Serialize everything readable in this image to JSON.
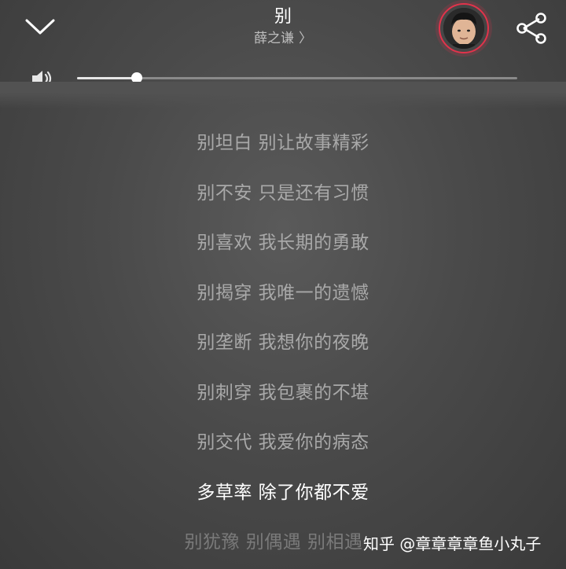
{
  "header": {
    "song_title": "别",
    "artist": "薛之谦",
    "artist_chevron": "〉"
  },
  "icons": {
    "collapse": "chevron-down-icon",
    "share": "share-icon",
    "volume": "speaker-icon"
  },
  "volume": {
    "level": 0.135
  },
  "lyrics": [
    {
      "text": "别坦白 别让故事精彩",
      "state": "normal"
    },
    {
      "text": "别不安 只是还有习惯",
      "state": "normal"
    },
    {
      "text": "别喜欢 我长期的勇敢",
      "state": "normal"
    },
    {
      "text": "别揭穿 我唯一的遗憾",
      "state": "normal"
    },
    {
      "text": "别垄断 我想你的夜晚",
      "state": "normal"
    },
    {
      "text": "别刺穿 我包裹的不堪",
      "state": "normal"
    },
    {
      "text": "别交代 我爱你的病态",
      "state": "normal"
    },
    {
      "text": "多草率 除了你都不爱",
      "state": "current"
    },
    {
      "text": "别犹豫 别偶遇 别相遇",
      "state": "faded"
    }
  ],
  "watermark": "知乎 @章章章章鱼小丸子",
  "colors": {
    "avatar_ring": "#e2334b",
    "current_lyric": "#ffffff",
    "lyric": "#a9a9a9"
  }
}
